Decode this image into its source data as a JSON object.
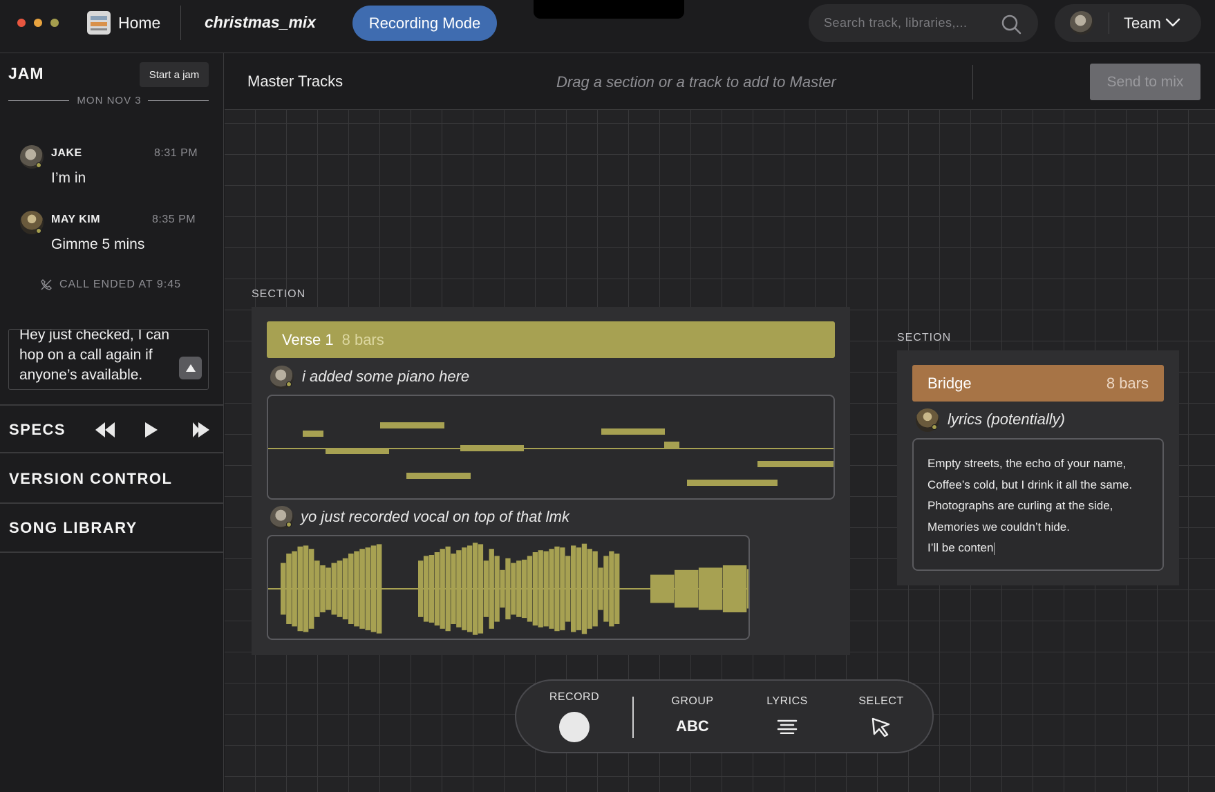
{
  "window": {
    "traffic_colors": [
      "#e8563f",
      "#e8a33f",
      "#a59e4e"
    ]
  },
  "topbar": {
    "home_label": "Home",
    "project_name": "christmas_mix",
    "mode_button": "Recording Mode",
    "search_placeholder": "Search track, libraries,...",
    "team_label": "Team"
  },
  "sidebar": {
    "jam_title": "JAM",
    "start_jam_label": "Start a jam",
    "date_label": "MON NOV 3",
    "messages": [
      {
        "name": "JAKE",
        "time": "8:31 PM",
        "text": "I’m in"
      },
      {
        "name": "MAY KIM",
        "time": "8:35 PM",
        "text": "Gimme 5 mins"
      }
    ],
    "call_ended": "CALL ENDED AT 9:45",
    "draft_message": "Hey just checked, I can hop on a call again if anyone’s available.",
    "sections": {
      "specs": "SPECS",
      "version_control": "VERSION CONTROL",
      "song_library": "SONG LIBRARY"
    }
  },
  "master": {
    "title": "Master Tracks",
    "hint": "Drag a section or a track to add to Master",
    "send_button": "Send to mix"
  },
  "sections": [
    {
      "label": "SECTION",
      "name": "Verse 1",
      "bars": "8 bars",
      "color": "#a7a152",
      "tracks": [
        {
          "comment": "i added some piano here",
          "type": "midi"
        },
        {
          "comment": "yo just recorded vocal on top of that lmk",
          "type": "audio"
        }
      ]
    },
    {
      "label": "SECTION",
      "name": "Bridge",
      "bars": "8 bars",
      "color": "#a77446",
      "tracks": [
        {
          "comment": "lyrics (potentially)",
          "type": "lyrics"
        }
      ],
      "lyrics": [
        "Empty streets, the echo of your name,",
        "Coffee’s cold, but I drink it all the same.",
        "Photographs are curling at the side,",
        "Memories we couldn’t hide.",
        "I’ll be conten"
      ]
    }
  ],
  "toolbar": {
    "record": "RECORD",
    "group": "GROUP",
    "group_glyph": "ABC",
    "lyrics": "LYRICS",
    "select": "SELECT"
  },
  "icons": {
    "transport": [
      "rewind-icon",
      "play-icon",
      "fast-forward-icon"
    ],
    "search": "search-icon",
    "dropdown": "chevron-down-icon",
    "send": "arrow-up-icon",
    "call": "phone-off-icon",
    "lyrics": "text-lines-icon",
    "select": "cursor-arrow-icon"
  }
}
